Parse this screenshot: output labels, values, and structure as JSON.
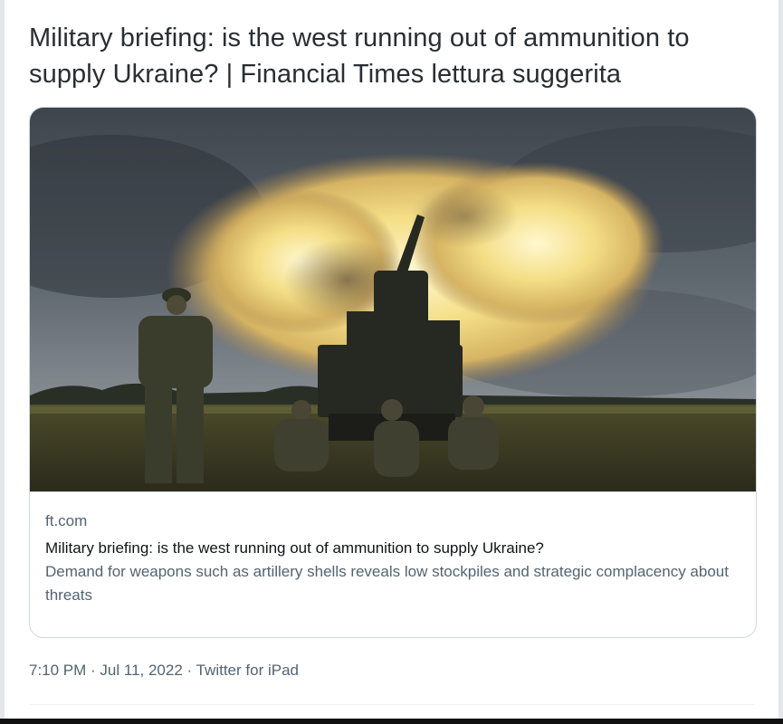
{
  "tweet": {
    "text": "Military briefing: is the west running out of ammunition to supply Ukraine? | Financial Times lettura suggerita"
  },
  "card": {
    "image_alt": "Soldiers beside an artillery howitzer firing in a field",
    "domain": "ft.com",
    "title": "Military briefing: is the west running out of ammunition to supply Ukraine?",
    "description": "Demand for weapons such as artillery shells reveals low stockpiles and strategic complacency about threats"
  },
  "meta": {
    "time": "7:10 PM",
    "sep1": " · ",
    "date": "Jul 11, 2022",
    "sep2": " · ",
    "source": "Twitter for iPad"
  },
  "colors": {
    "secondary_text": "#536471",
    "border": "#cfd9de"
  }
}
